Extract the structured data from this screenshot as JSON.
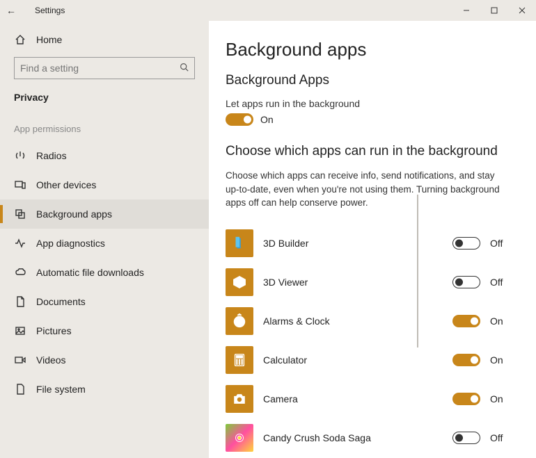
{
  "window": {
    "title": "Settings"
  },
  "sidebar": {
    "home_label": "Home",
    "search_placeholder": "Find a setting",
    "category_label": "Privacy",
    "group_label": "App permissions",
    "items": [
      {
        "icon": "radios-icon",
        "label": "Radios",
        "active": false
      },
      {
        "icon": "other-devices-icon",
        "label": "Other devices",
        "active": false
      },
      {
        "icon": "background-apps-icon",
        "label": "Background apps",
        "active": true
      },
      {
        "icon": "diagnostics-icon",
        "label": "App diagnostics",
        "active": false
      },
      {
        "icon": "cloud-download-icon",
        "label": "Automatic file downloads",
        "active": false
      },
      {
        "icon": "document-icon",
        "label": "Documents",
        "active": false
      },
      {
        "icon": "picture-icon",
        "label": "Pictures",
        "active": false
      },
      {
        "icon": "video-icon",
        "label": "Videos",
        "active": false
      },
      {
        "icon": "file-system-icon",
        "label": "File system",
        "active": false
      }
    ]
  },
  "page": {
    "title": "Background apps",
    "master": {
      "heading": "Background Apps",
      "label": "Let apps run in the background",
      "state_on": "On",
      "state_off": "Off",
      "value": true
    },
    "choose": {
      "heading": "Choose which apps can run in the background",
      "description": "Choose which apps can receive info, send notifications, and stay up-to-date, even when you're not using them. Turning background apps off can help conserve power."
    },
    "apps": [
      {
        "name": "3D Builder",
        "tile_color": "#c8861a",
        "icon": "cube-icon",
        "enabled": false
      },
      {
        "name": "3D Viewer",
        "tile_color": "#c8861a",
        "icon": "cube-outline-icon",
        "enabled": false
      },
      {
        "name": "Alarms & Clock",
        "tile_color": "#c8861a",
        "icon": "clock-icon",
        "enabled": true
      },
      {
        "name": "Calculator",
        "tile_color": "#c8861a",
        "icon": "calculator-icon",
        "enabled": true
      },
      {
        "name": "Camera",
        "tile_color": "#c8861a",
        "icon": "camera-icon",
        "enabled": true
      },
      {
        "name": "Candy Crush Soda Saga",
        "tile_color": "candy",
        "icon": "candy-icon",
        "enabled": false
      }
    ],
    "state_labels": {
      "on": "On",
      "off": "Off"
    }
  }
}
